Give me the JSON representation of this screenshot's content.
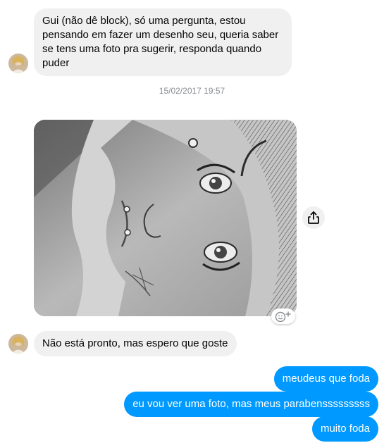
{
  "conversation": {
    "messages_in": [
      {
        "text": "Gui (não dê block), só uma pergunta, estou pensando em fazer um desenho seu, queria saber se tens uma foto pra sugerir, responda quando puder"
      },
      {
        "text": "Não está pronto, mas espero que goste"
      }
    ],
    "timestamp": "15/02/2017 19:57",
    "messages_out": [
      {
        "text": "meudeus que foda"
      },
      {
        "text": "eu vou ver uma foto, mas meus parabensssssssss"
      },
      {
        "text": "muito foda"
      }
    ]
  },
  "icons": {
    "share": "share-icon",
    "reaction": "add-reaction-icon"
  },
  "colors": {
    "outgoing_bubble": "#0099ff",
    "incoming_bubble": "#f0f0f0",
    "timestamp": "#8a8d91"
  }
}
